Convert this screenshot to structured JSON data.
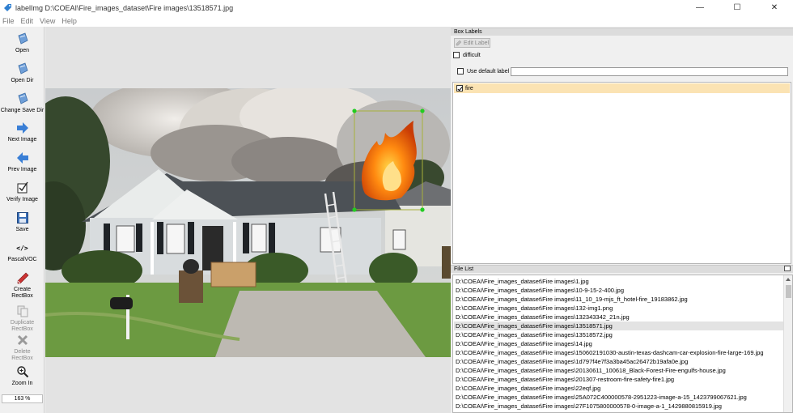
{
  "window": {
    "title": "labelImg D:\\COEAI\\Fire_images_dataset\\Fire images\\13518571.jpg",
    "controls": [
      "—",
      "☐",
      "✕"
    ]
  },
  "menu": [
    "File",
    "Edit",
    "View",
    "Help"
  ],
  "toolbar": {
    "open": "Open",
    "open_dir": "Open Dir",
    "change_save_dir": "Change Save Dir",
    "next_image": "Next Image",
    "prev_image": "Prev Image",
    "verify_image": "Verify Image",
    "save": "Save",
    "format": "PascalVOC",
    "format_icon": "</>",
    "create_rectbox_1": "Create",
    "create_rectbox_2": "RectBox",
    "duplicate_rectbox_1": "Duplicate",
    "duplicate_rectbox_2": "RectBox",
    "delete_rectbox_1": "Delete",
    "delete_rectbox_2": "RectBox",
    "zoom_in": "Zoom In",
    "zoom_value": "163 %"
  },
  "box_labels": {
    "title": "Box Labels",
    "edit_label": "Edit Label",
    "difficult": "difficult",
    "difficult_checked": false,
    "use_default_label": "Use default label",
    "use_default_checked": false,
    "default_label_value": "",
    "labels": [
      {
        "name": "fire",
        "checked": true
      }
    ]
  },
  "file_list": {
    "title": "File List",
    "selected_index": 5,
    "files": [
      "D:\\COEAI\\Fire_images_dataset\\Fire images\\1.jpg",
      "D:\\COEAI\\Fire_images_dataset\\Fire images\\10-9-15-2-400.jpg",
      "D:\\COEAI\\Fire_images_dataset\\Fire images\\11_10_19-mjs_ft_hotel-fire_19183862.jpg",
      "D:\\COEAI\\Fire_images_dataset\\Fire images\\132-img1.png",
      "D:\\COEAI\\Fire_images_dataset\\Fire images\\132343342_21n.jpg",
      "D:\\COEAI\\Fire_images_dataset\\Fire images\\13518571.jpg",
      "D:\\COEAI\\Fire_images_dataset\\Fire images\\13518572.jpg",
      "D:\\COEAI\\Fire_images_dataset\\Fire images\\14.jpg",
      "D:\\COEAI\\Fire_images_dataset\\Fire images\\150602191030-austin-texas-dashcam-car-explosion-fire-large-169.jpg",
      "D:\\COEAI\\Fire_images_dataset\\Fire images\\1d797f4e7f3a3ba45ac26472b19afa0e.jpg",
      "D:\\COEAI\\Fire_images_dataset\\Fire images\\20130611_100618_Black-Forest-Fire-engulfs-house.jpg",
      "D:\\COEAI\\Fire_images_dataset\\Fire images\\201307-restroom-fire-safety-fire1.jpg",
      "D:\\COEAI\\Fire_images_dataset\\Fire images\\22eqf.jpg",
      "D:\\COEAI\\Fire_images_dataset\\Fire images\\25A072C400000578-2951223-image-a-15_1423799067621.jpg",
      "D:\\COEAI\\Fire_images_dataset\\Fire images\\27F1075800000578-0-image-a-1_1429880815919.jpg"
    ]
  },
  "colors": {
    "selected_label_bg": "#fbe3b3",
    "bbox_stroke": "#a8b03a",
    "bbox_handles": "#22cc22"
  }
}
